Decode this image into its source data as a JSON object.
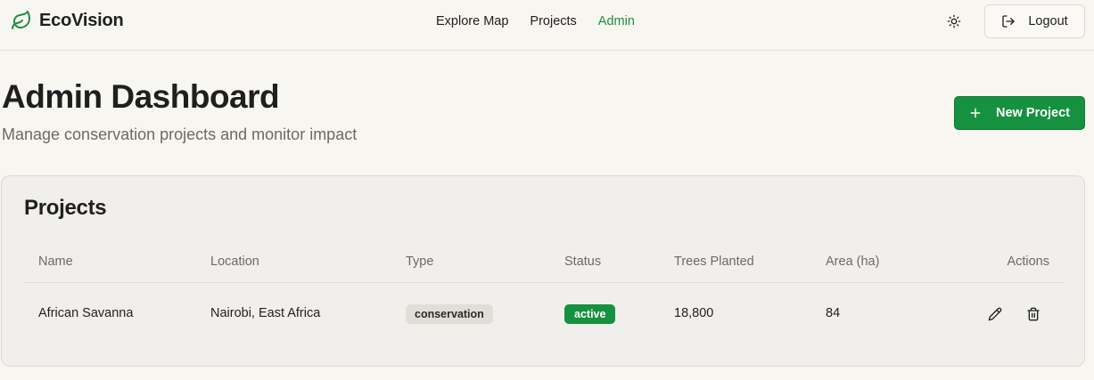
{
  "header": {
    "brand": "EcoVision",
    "nav": [
      {
        "label": "Explore Map",
        "active": false
      },
      {
        "label": "Projects",
        "active": false
      },
      {
        "label": "Admin",
        "active": true
      }
    ],
    "theme_toggle_icon": "sun-icon",
    "logout_label": "Logout",
    "logout_icon": "logout-icon"
  },
  "page": {
    "title": "Admin Dashboard",
    "subtitle": "Manage conservation projects and monitor impact",
    "new_project_label": "New Project"
  },
  "projects_card": {
    "title": "Projects",
    "columns": [
      "Name",
      "Location",
      "Type",
      "Status",
      "Trees Planted",
      "Area (ha)",
      "Actions"
    ],
    "rows": [
      {
        "name": "African Savanna",
        "location": "Nairobi, East Africa",
        "type": "conservation",
        "status": "active",
        "trees_planted": "18,800",
        "area_ha": "84",
        "actions": [
          "edit-icon",
          "trash-icon"
        ]
      }
    ]
  },
  "colors": {
    "brand_green": "#16913f",
    "active_nav": "#1e8e3e",
    "background": "#f8f6f1",
    "card": "#f1efec"
  }
}
